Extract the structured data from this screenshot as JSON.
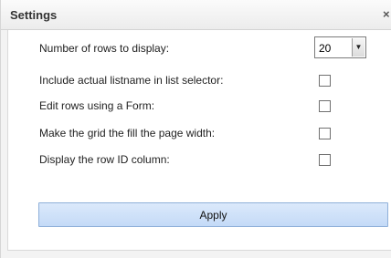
{
  "dialog": {
    "title": "Settings",
    "close_glyph": "×"
  },
  "settings": {
    "rows_label": "Number of rows to display:",
    "rows_value": "20",
    "listname_label": "Include actual listname in list selector:",
    "listname_checked": false,
    "form_label": "Edit rows using a Form:",
    "form_checked": false,
    "fill_width_label": "Make the grid the fill the page width:",
    "fill_width_checked": false,
    "row_id_label": "Display the row ID column:",
    "row_id_checked": false
  },
  "actions": {
    "apply_label": "Apply"
  },
  "icons": {
    "close": "close-icon",
    "dropdown": "chevron-down-icon"
  }
}
